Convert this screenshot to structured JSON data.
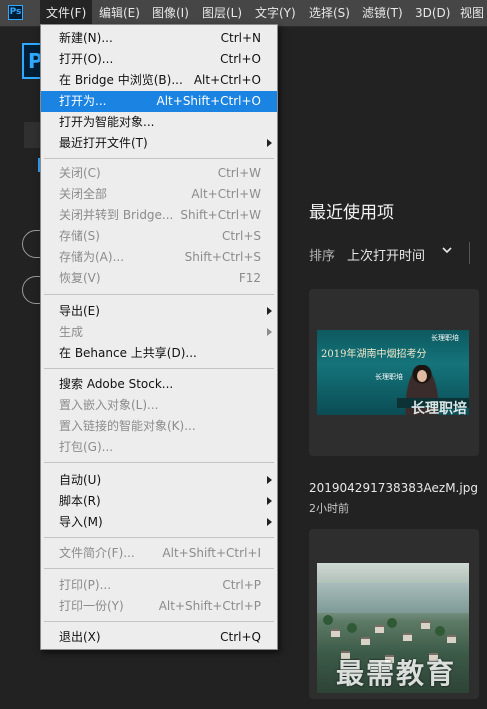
{
  "menubar": {
    "logo": "Ps",
    "items": [
      "文件(F)",
      "编辑(E)",
      "图像(I)",
      "图层(L)",
      "文字(Y)",
      "选择(S)",
      "滤镜(T)",
      "3D(D)",
      "视图"
    ]
  },
  "app_logo": "P",
  "home": {
    "recent_title": "最近使用项",
    "sort_label": "排序",
    "sort_value": "上次打开时间",
    "sort_chevron": "chevron-down-icon",
    "files": [
      {
        "name": "201904291738383AezM.jpg",
        "time": "2小时前",
        "thumb_banner": "2019年湖南中烟招考分",
        "thumb_sub": "长理职培",
        "thumb_brand": "长理职培",
        "thumb_bottom": "长理职培"
      },
      {
        "name": "",
        "time": ""
      }
    ],
    "watermark": "最需教育"
  },
  "file_menu": {
    "items": [
      {
        "label": "新建(N)...",
        "shortcut": "Ctrl+N",
        "enabled": true
      },
      {
        "label": "打开(O)...",
        "shortcut": "Ctrl+O",
        "enabled": true
      },
      {
        "label": "在 Bridge 中浏览(B)...",
        "shortcut": "Alt+Ctrl+O",
        "enabled": true
      },
      {
        "label": "打开为...",
        "shortcut": "Alt+Shift+Ctrl+O",
        "enabled": true,
        "highlighted": true
      },
      {
        "label": "打开为智能对象...",
        "shortcut": "",
        "enabled": true
      },
      {
        "label": "最近打开文件(T)",
        "shortcut": "",
        "enabled": true,
        "submenu": true
      },
      {
        "label": "关闭(C)",
        "shortcut": "Ctrl+W",
        "enabled": false
      },
      {
        "label": "关闭全部",
        "shortcut": "Alt+Ctrl+W",
        "enabled": false
      },
      {
        "label": "关闭并转到 Bridge...",
        "shortcut": "Shift+Ctrl+W",
        "enabled": false
      },
      {
        "label": "存储(S)",
        "shortcut": "Ctrl+S",
        "enabled": false
      },
      {
        "label": "存储为(A)...",
        "shortcut": "Shift+Ctrl+S",
        "enabled": false
      },
      {
        "label": "恢复(V)",
        "shortcut": "F12",
        "enabled": false
      },
      {
        "label": "导出(E)",
        "shortcut": "",
        "enabled": true,
        "submenu": true
      },
      {
        "label": "生成",
        "shortcut": "",
        "enabled": false,
        "submenu": true
      },
      {
        "label": "在 Behance 上共享(D)...",
        "shortcut": "",
        "enabled": true
      },
      {
        "label": "搜索 Adobe Stock...",
        "shortcut": "",
        "enabled": true
      },
      {
        "label": "置入嵌入对象(L)...",
        "shortcut": "",
        "enabled": false
      },
      {
        "label": "置入链接的智能对象(K)...",
        "shortcut": "",
        "enabled": false
      },
      {
        "label": "打包(G)...",
        "shortcut": "",
        "enabled": false
      },
      {
        "label": "自动(U)",
        "shortcut": "",
        "enabled": true,
        "submenu": true
      },
      {
        "label": "脚本(R)",
        "shortcut": "",
        "enabled": true,
        "submenu": true
      },
      {
        "label": "导入(M)",
        "shortcut": "",
        "enabled": true,
        "submenu": true
      },
      {
        "label": "文件简介(F)...",
        "shortcut": "Alt+Shift+Ctrl+I",
        "enabled": false
      },
      {
        "label": "打印(P)...",
        "shortcut": "Ctrl+P",
        "enabled": false
      },
      {
        "label": "打印一份(Y)",
        "shortcut": "Alt+Shift+Ctrl+P",
        "enabled": false
      },
      {
        "label": "退出(X)",
        "shortcut": "Ctrl+Q",
        "enabled": true
      }
    ]
  }
}
